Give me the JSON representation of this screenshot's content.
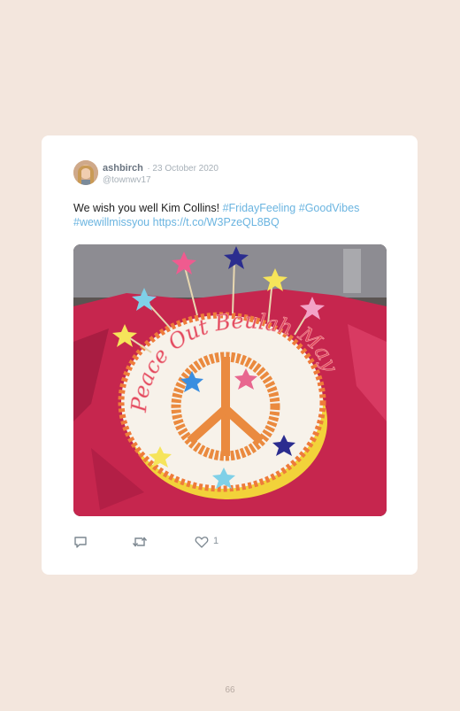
{
  "post": {
    "username": "ashbirch",
    "date": "· 23 October 2020",
    "handle": "@townwv17",
    "text_plain": "We wish you well Kim Collins! ",
    "hashtags": [
      "#FridayFeeling",
      "#GoodVibes",
      "#wewillmissyou"
    ],
    "link": "https://t.co/W3PzeQL8BQ",
    "cake_lettering": "Peace Out Beulah May",
    "like_count": "1"
  },
  "icons": {
    "reply": "reply-icon",
    "retweet": "retweet-icon",
    "like": "heart-icon"
  },
  "page": {
    "number": "66"
  },
  "colors": {
    "background": "#f3e6dd",
    "card": "#ffffff",
    "hashtag": "#6ab4e0",
    "meta": "#a7b0b8"
  }
}
